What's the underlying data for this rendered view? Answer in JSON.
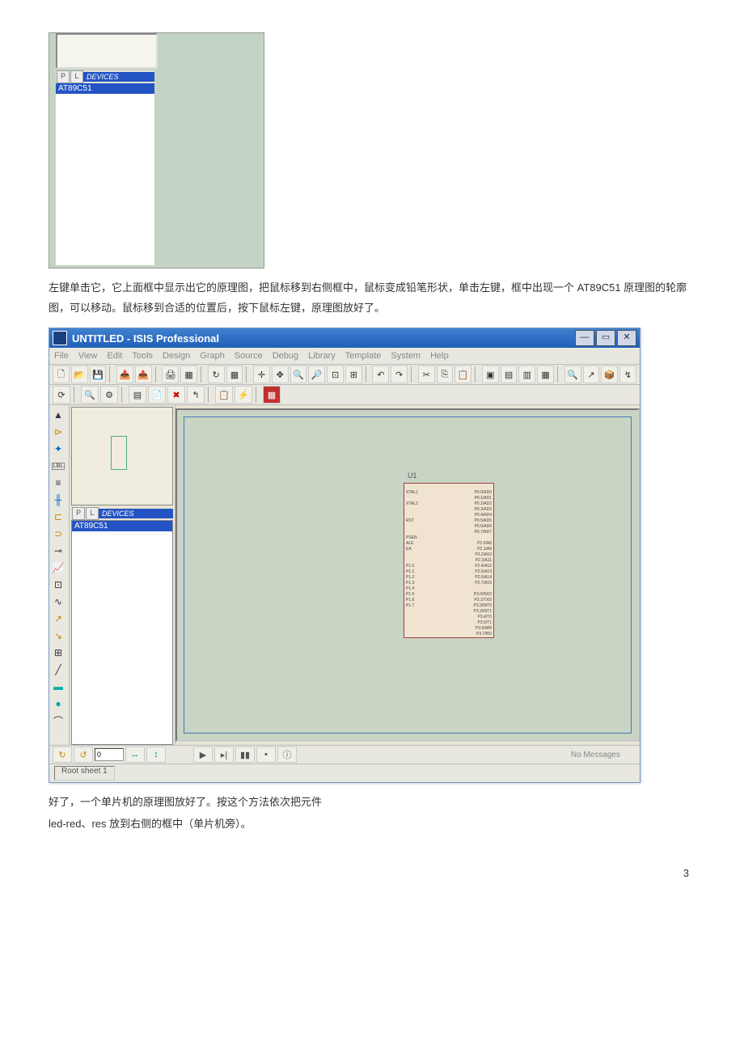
{
  "fig1": {
    "devices_label": "DEVICES",
    "p_btn": "P",
    "l_btn": "L",
    "item": "AT89C51"
  },
  "para1": "左键单击它，它上面框中显示出它的原理图，把鼠标移到右侧框中，鼠标变成铅笔形状，单击左键，框中出现一个 AT89C51 原理图的轮廓图，可以移动。鼠标移到合适的位置后，按下鼠标左键，原理图放好了。",
  "app": {
    "title": "UNTITLED - ISIS Professional",
    "menu": [
      "File",
      "View",
      "Edit",
      "Tools",
      "Design",
      "Graph",
      "Source",
      "Debug",
      "Library",
      "Template",
      "System",
      "Help"
    ],
    "devices_label": "DEVICES",
    "p_btn": "P",
    "l_btn": "L",
    "item": "AT89C51",
    "chip_ref": "U1",
    "bottom_value": "0",
    "no_messages": "No Messages",
    "status": "Root sheet 1",
    "pins_left": [
      "XTAL1",
      "",
      "XTAL2",
      "",
      "",
      "RST",
      "",
      "",
      "PSEN",
      "ALE",
      "EA",
      "",
      "",
      "P1.0",
      "P1.1",
      "P1.2",
      "P1.3",
      "P1.4",
      "P1.5",
      "P1.6",
      "P1.7"
    ],
    "pins_right": [
      "P0.0/AD0",
      "P0.1/AD1",
      "P0.2/AD2",
      "P0.3/AD3",
      "P0.4/AD4",
      "P0.5/AD5",
      "P0.6/AD6",
      "P0.7/AD7",
      "",
      "P2.0/A8",
      "P2.1/A9",
      "P2.2/A10",
      "P2.3/A11",
      "P2.4/A12",
      "P2.5/A13",
      "P2.6/A14",
      "P2.7/A15",
      "",
      "P3.0/RXD",
      "P3.1/TXD",
      "P3.2/INT0",
      "P3.3/INT1",
      "P3.4/T0",
      "P3.5/T1",
      "P3.6/WR",
      "P3.7/RD"
    ]
  },
  "para2": "好了，一个单片机的原理图放好了。按这个方法依次把元件",
  "para3": "led-red、res 放到右侧的框中（单片机旁）。",
  "page_num": "3"
}
